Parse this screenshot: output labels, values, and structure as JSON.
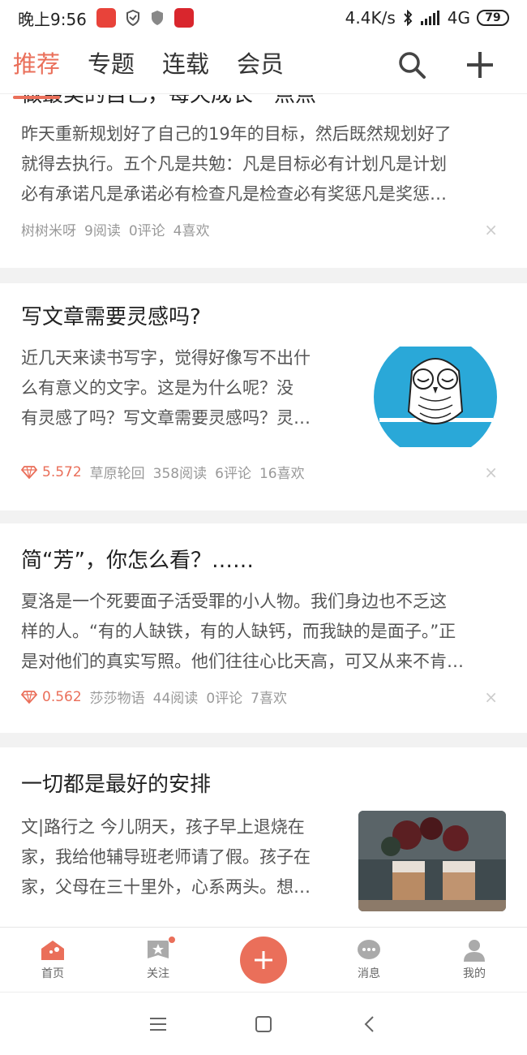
{
  "status_bar": {
    "time": "晚上9:56",
    "net_speed": "4.4K/s",
    "network": "4G",
    "battery": "79"
  },
  "top_nav": {
    "tabs": [
      {
        "label": "推荐",
        "active": true
      },
      {
        "label": "专题",
        "active": false
      },
      {
        "label": "连载",
        "active": false
      },
      {
        "label": "会员",
        "active": false
      }
    ],
    "search_icon": "search-icon",
    "add_icon": "plus-icon"
  },
  "feed": {
    "articles": [
      {
        "title": "做最美的自己，每天成长一点点",
        "summary_lines": [
          "昨天重新规划好了自己的19年的目标，然后既然规划好了",
          "就得去执行。五个凡是共勉：凡是目标必有计划凡是计划",
          "必有承诺凡是承诺必有检查凡是检查必有奖惩凡是奖惩…"
        ],
        "author": "树树米呀",
        "reads": "9阅读",
        "comments": "0评论",
        "likes": "4喜欢",
        "diamond": ""
      },
      {
        "title": "写文章需要灵感吗?",
        "summary_lines": [
          "近几天来读书写字，觉得好像写不出什",
          "么有意义的文字。这是为什么呢？没",
          "有灵感了吗？写文章需要灵感吗？灵…"
        ],
        "author": "草原轮回",
        "reads": "358阅读",
        "comments": "6评论",
        "likes": "16喜欢",
        "diamond": "5.572"
      },
      {
        "title": "简“芳”，你怎么看？……",
        "summary_lines": [
          "夏洛是一个死要面子活受罪的小人物。我们身边也不乏这",
          "样的人。“有的人缺铁，有的人缺钙，而我缺的是面子。”正",
          "是对他们的真实写照。他们往往心比天高，可又从来不肯…"
        ],
        "author": "莎莎物语",
        "reads": "44阅读",
        "comments": "0评论",
        "likes": "7喜欢",
        "diamond": "0.562"
      },
      {
        "title": "一切都是最好的安排",
        "summary_lines": [
          "文|路行之 今儿阴天，孩子早上退烧在",
          "家，我给他辅导班老师请了假。孩子在",
          "家，父母在三十里外，心系两头。想…"
        ],
        "author": "",
        "reads": "",
        "comments": "",
        "likes": "",
        "diamond": ""
      }
    ],
    "close_glyph": "×"
  },
  "bottom_bar": {
    "items": [
      {
        "label": "首页",
        "icon": "home-icon"
      },
      {
        "label": "关注",
        "icon": "follow-icon"
      },
      {
        "label": "",
        "icon": "write-plus-icon"
      },
      {
        "label": "消息",
        "icon": "message-icon"
      },
      {
        "label": "我的",
        "icon": "profile-icon"
      }
    ]
  },
  "colors": {
    "accent": "#ea6f5a",
    "owl_bg": "#2aa8d8"
  }
}
